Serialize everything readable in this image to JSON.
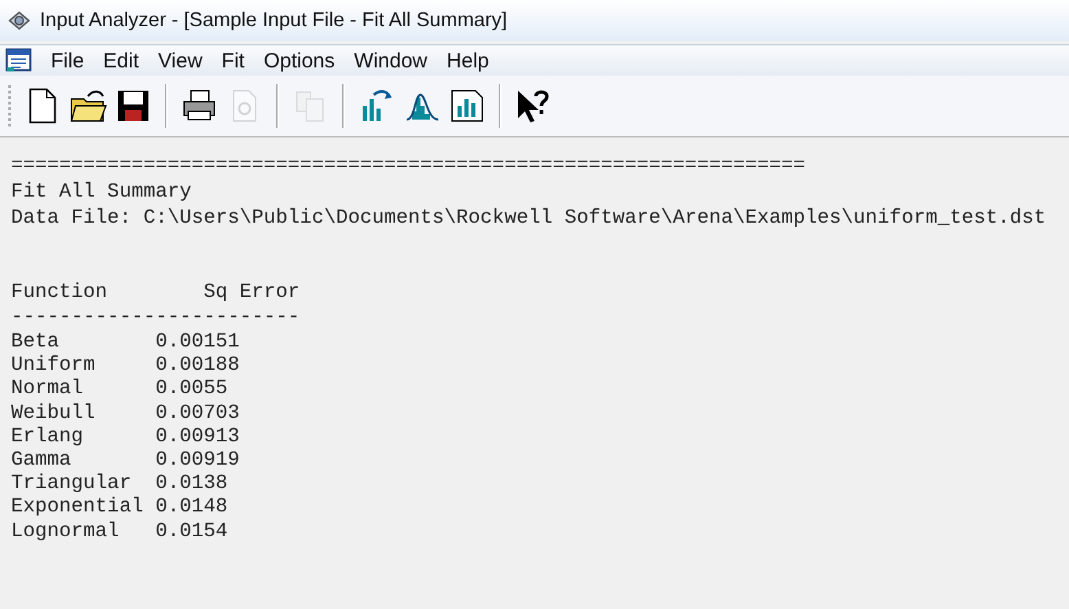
{
  "window": {
    "title": "Input Analyzer - [Sample Input File - Fit All Summary]"
  },
  "menu": [
    {
      "label": "File"
    },
    {
      "label": "Edit"
    },
    {
      "label": "View"
    },
    {
      "label": "Fit"
    },
    {
      "label": "Options"
    },
    {
      "label": "Window"
    },
    {
      "label": "Help"
    }
  ],
  "toolbar": [
    {
      "kind": "new",
      "disabled": false
    },
    {
      "kind": "open",
      "disabled": false
    },
    {
      "kind": "save",
      "disabled": false
    },
    {
      "kind": "sep"
    },
    {
      "kind": "print",
      "disabled": false
    },
    {
      "kind": "preview",
      "disabled": true
    },
    {
      "kind": "sep"
    },
    {
      "kind": "copy",
      "disabled": true
    },
    {
      "kind": "sep"
    },
    {
      "kind": "fit",
      "disabled": false
    },
    {
      "kind": "distribution",
      "disabled": false
    },
    {
      "kind": "histogram",
      "disabled": false
    },
    {
      "kind": "sep"
    },
    {
      "kind": "help",
      "disabled": false
    }
  ],
  "report": {
    "separator": "==================================================================",
    "title": "Fit All Summary",
    "data_file": "Data File: C:\\Users\\Public\\Documents\\Rockwell Software\\Arena\\Examples\\uniform_test.dst",
    "columns": [
      "Function",
      "Sq Error"
    ],
    "rule": "------------------------",
    "rows": [
      {
        "function": "Beta",
        "sq_error": "0.00151"
      },
      {
        "function": "Uniform",
        "sq_error": "0.00188"
      },
      {
        "function": "Normal",
        "sq_error": "0.0055"
      },
      {
        "function": "Weibull",
        "sq_error": "0.00703"
      },
      {
        "function": "Erlang",
        "sq_error": "0.00913"
      },
      {
        "function": "Gamma",
        "sq_error": "0.00919"
      },
      {
        "function": "Triangular",
        "sq_error": "0.0138"
      },
      {
        "function": "Exponential",
        "sq_error": "0.0148"
      },
      {
        "function": "Lognormal",
        "sq_error": "0.0154"
      }
    ]
  }
}
